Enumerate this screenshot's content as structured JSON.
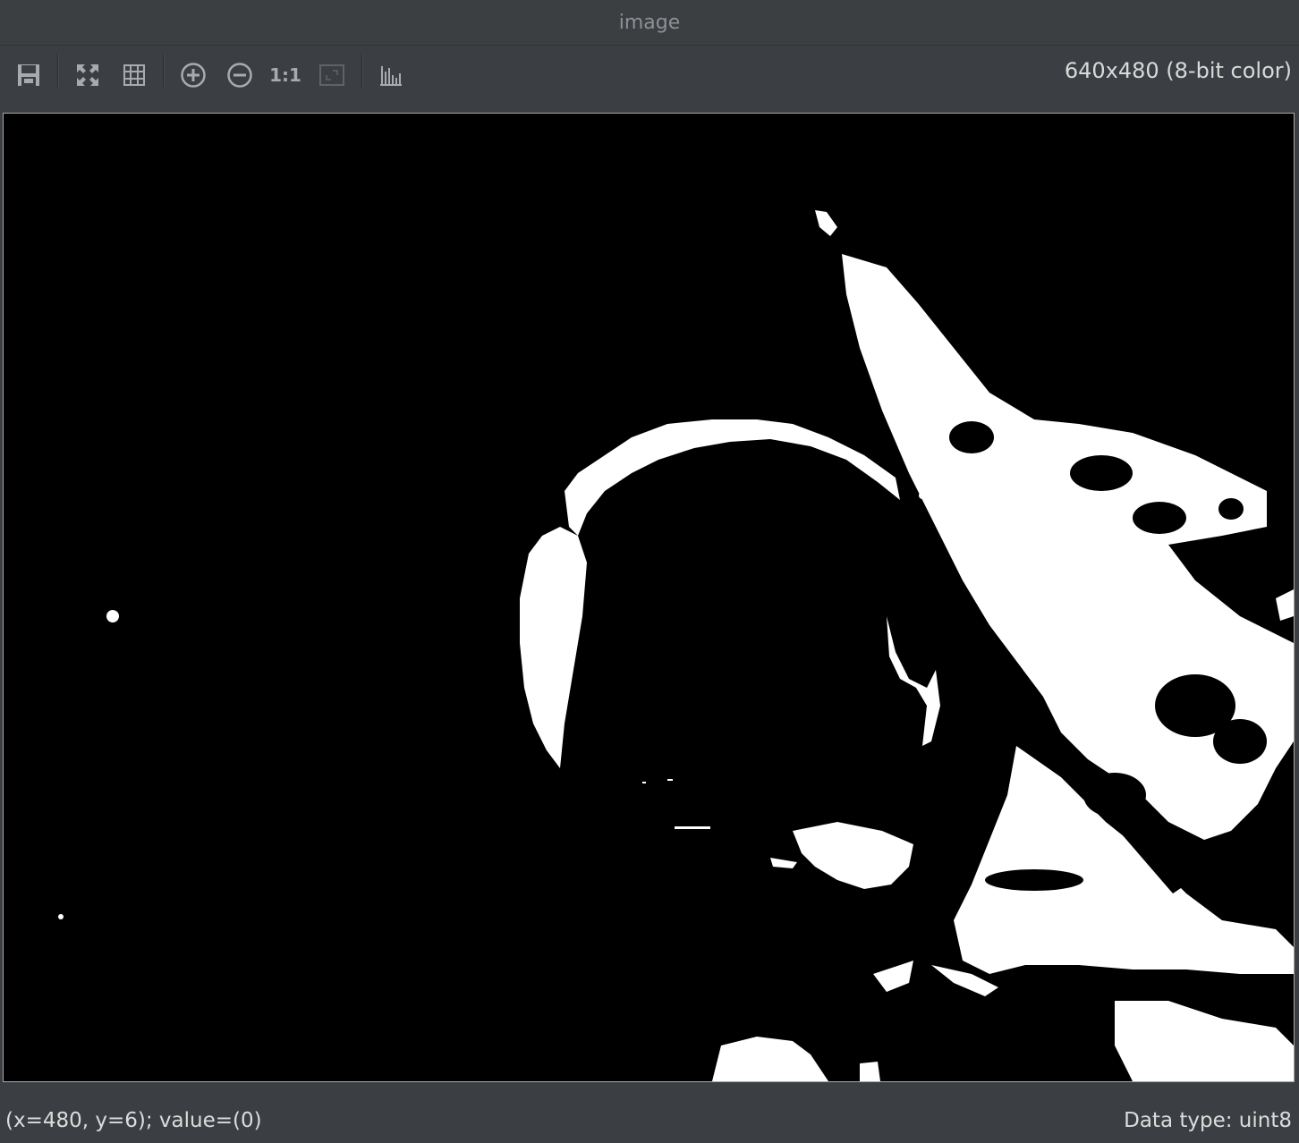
{
  "window": {
    "title": "image"
  },
  "toolbar": {
    "buttons": [
      {
        "icon": "save-icon",
        "label": "Save"
      },
      {
        "icon": "fit-window-icon",
        "label": "Fit to window"
      },
      {
        "icon": "grid-icon",
        "label": "Pixel grid"
      },
      {
        "icon": "zoom-in-icon",
        "label": "Zoom in"
      },
      {
        "icon": "zoom-out-icon",
        "label": "Zoom out"
      },
      {
        "icon": "actual-size-icon",
        "label": "1:1"
      },
      {
        "icon": "zoom-rect-icon",
        "label": "Zoom to region"
      },
      {
        "icon": "histogram-icon",
        "label": "Histogram"
      }
    ],
    "actual_size_label": "1:1",
    "image_info": "640x480 (8-bit color)"
  },
  "status": {
    "pixel_readout": "(x=480, y=6); value=(0)",
    "data_type": "Data type: uint8"
  },
  "colors": {
    "chrome_bg": "#3b3f43",
    "canvas_bg": "#000000",
    "foreground_pixels": "#ffffff"
  }
}
